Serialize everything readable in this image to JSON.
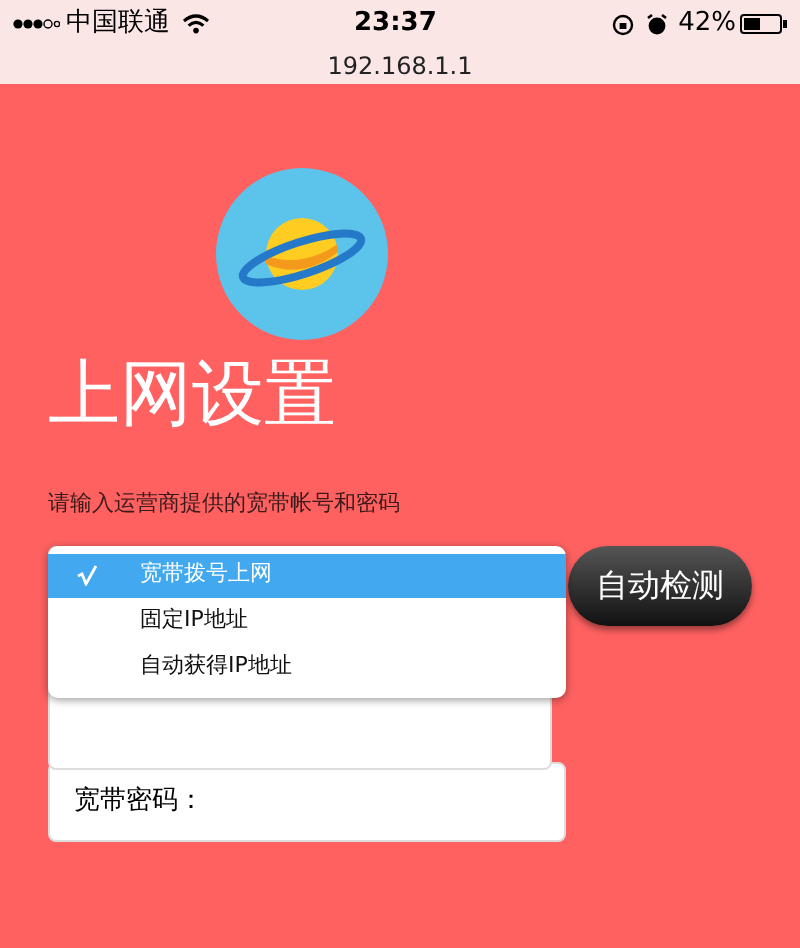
{
  "status_bar": {
    "carrier": "中国联通",
    "time": "23:37",
    "battery": "42%",
    "url": "192.168.1.1"
  },
  "page": {
    "title": "上网设置",
    "instruction": "请输入运营商提供的宽带帐号和密码"
  },
  "connection_menu": {
    "options": [
      {
        "label": "宽带拨号上网",
        "selected": true
      },
      {
        "label": "固定IP地址",
        "selected": false
      },
      {
        "label": "自动获得IP地址",
        "selected": false
      }
    ]
  },
  "auto_detect_button": "自动检测",
  "password_field": {
    "label": "宽带密码："
  }
}
